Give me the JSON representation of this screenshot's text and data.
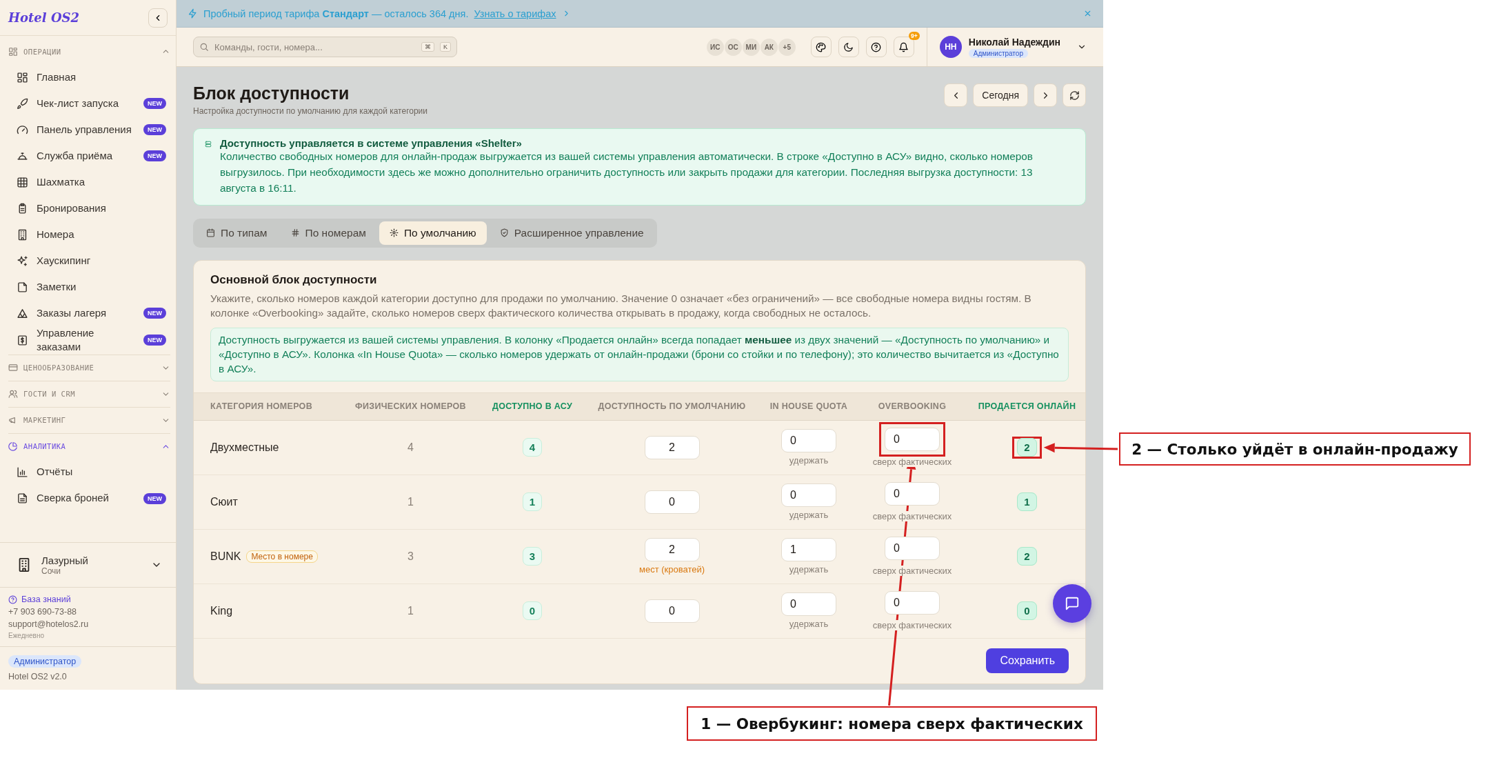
{
  "sidebar": {
    "logo": "Hotel OS2",
    "sections": [
      {
        "title": "ОПЕРАЦИИ",
        "expanded": true,
        "active": false,
        "items": [
          {
            "label": "Главная"
          },
          {
            "label": "Чек-лист запуска",
            "badge": "NEW"
          },
          {
            "label": "Панель управления",
            "badge": "NEW"
          },
          {
            "label": "Служба приёма",
            "badge": "NEW"
          },
          {
            "label": "Шахматка"
          },
          {
            "label": "Бронирования"
          },
          {
            "label": "Номера"
          },
          {
            "label": "Хаускипинг"
          },
          {
            "label": "Заметки"
          },
          {
            "label": "Заказы лагеря",
            "badge": "NEW"
          },
          {
            "label": "Управление заказами",
            "badge": "NEW"
          }
        ]
      },
      {
        "title": "ЦЕНООБРАЗОВАНИЕ",
        "expanded": false,
        "active": false
      },
      {
        "title": "ГОСТИ И CRM",
        "expanded": false,
        "active": false
      },
      {
        "title": "МАРКЕТИНГ",
        "expanded": false,
        "active": false
      },
      {
        "title": "АНАЛИТИКА",
        "expanded": true,
        "active": true,
        "items": [
          {
            "label": "Отчёты"
          },
          {
            "label": "Сверка броней",
            "badge": "NEW"
          }
        ]
      }
    ],
    "hotel": {
      "name": "Лазурный",
      "city": "Сочи"
    },
    "help": {
      "link": "База знаний",
      "phone": "+7 903 690-73-88",
      "email": "support@hotelos2.ru",
      "hours": "Ежедневно"
    },
    "role": "Администратор",
    "version": "Hotel OS2 v2.0"
  },
  "banner": {
    "text": "Пробный период тарифа **Стандарт** — осталось 364 дня.",
    "link": "Узнать о тарифах"
  },
  "topbar": {
    "search": {
      "placeholder": "Команды, гости, номера...",
      "keys": [
        "⌘",
        "K"
      ]
    },
    "avatars": [
      "ИС",
      "ОС",
      "МИ",
      "АК"
    ],
    "more": "+5",
    "notifications": "9+",
    "user": {
      "initials": "НН",
      "name": "Николай Надеждин",
      "role": "Администратор"
    }
  },
  "page": {
    "title": "Блок доступности",
    "subtitle": "Настройка доступности по умолчанию для каждой категории",
    "today": "Сегодня"
  },
  "callout": {
    "title": "Доступность управляется в системе управления «Shelter»",
    "text": "Количество свободных номеров для онлайн-продаж выгружается из вашей системы управления автоматически. В строке «Доступно в АСУ» видно, сколько номеров выгрузилось. При необходимости здесь же можно дополнительно ограничить доступность или закрыть продажи для категории. Последняя выгрузка доступности: 13 августа в 16:11."
  },
  "tabs": [
    {
      "label": "По типам",
      "selected": false
    },
    {
      "label": "По номерам",
      "selected": false
    },
    {
      "label": "По умолчанию",
      "selected": true
    },
    {
      "label": "Расширенное управление",
      "selected": false
    }
  ],
  "card": {
    "title": "Основной блок доступности",
    "description": "Укажите, сколько номеров каждой категории доступно для продажи по умолчанию. Значение 0 означает «без ограничений» — все свободные номера видны гостям. В колонке «Overbooking» задайте, сколько номеров сверх фактического количества открывать в продажу, когда свободных не осталось.",
    "note": "Доступность выгружается из вашей системы управления. В колонку «Продается онлайн» всегда попадает **меньшее** из двух значений — «Доступность по умолчанию» и «Доступно в АСУ». Колонка «In House Quota» — сколько номеров удержать от онлайн-продажи (брони со стойки и по телефону); это количество вычитается из «Доступно в АСУ».",
    "columns": [
      {
        "label": "КАТЕГОРИЯ НОМЕРОВ",
        "accent": false
      },
      {
        "label": "ФИЗИЧЕСКИХ НОМЕРОВ",
        "accent": false
      },
      {
        "label": "ДОСТУПНО В АСУ",
        "accent": true
      },
      {
        "label": "ДОСТУПНОСТЬ ПО УМОЛЧАНИЮ",
        "accent": false
      },
      {
        "label": "IN HOUSE QUOTA",
        "accent": false
      },
      {
        "label": "OVERBOOKING",
        "accent": false
      },
      {
        "label": "ПРОДАЕТСЯ ОНЛАЙН",
        "accent": true
      }
    ],
    "rows": [
      {
        "category": "Двухместные",
        "physical": "4",
        "asu": "4",
        "default": "2",
        "in_house": "0",
        "in_house_hint": "удержать",
        "overbooking": "0",
        "overbooking_hint": "сверх фактических",
        "online": "2",
        "overbooking_marked": true,
        "online_marked": true
      },
      {
        "category": "Сюит",
        "physical": "1",
        "asu": "1",
        "default": "0",
        "in_house": "0",
        "in_house_hint": "удержать",
        "overbooking": "0",
        "overbooking_hint": "сверх фактических",
        "online": "1",
        "overbooking_marked": false,
        "online_marked": false
      },
      {
        "category": "BUNK",
        "tag": "Место в номере",
        "physical": "3",
        "asu": "3",
        "default": "2",
        "default_hint": "мест (кроватей)",
        "in_house": "1",
        "in_house_hint": "удержать",
        "overbooking": "0",
        "overbooking_hint": "сверх фактических",
        "online": "2",
        "overbooking_marked": false,
        "online_marked": false
      },
      {
        "category": "King",
        "physical": "1",
        "asu": "0",
        "default": "0",
        "in_house": "0",
        "in_house_hint": "удержать",
        "overbooking": "0",
        "overbooking_hint": "сверх фактических",
        "online": "0",
        "overbooking_marked": false,
        "online_marked": false
      }
    ],
    "save": "Сохранить"
  },
  "annotations": [
    {
      "label": "1 — Овербукинг: номера сверх фактических",
      "kind": "below"
    },
    {
      "label": "2 — Столько уйдёт в онлайн-продажу",
      "kind": "right"
    }
  ]
}
